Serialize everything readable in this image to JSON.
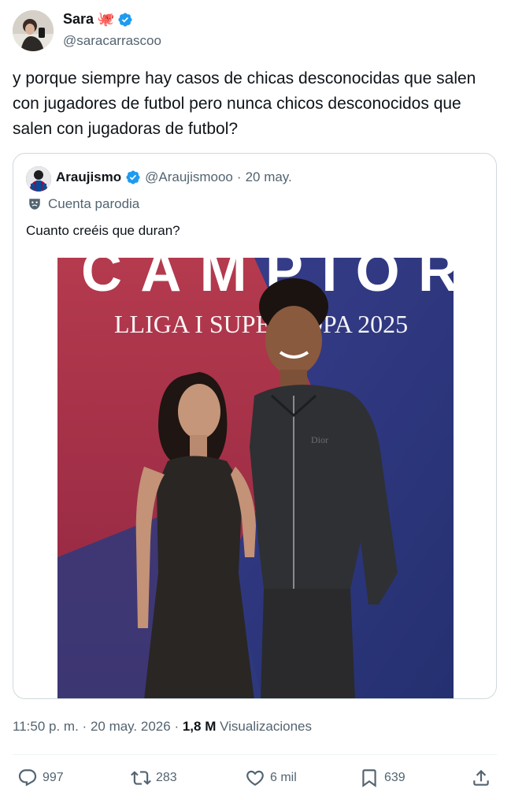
{
  "author": {
    "name": "Sara",
    "emoji": "🐙",
    "handle": "@saracarrascoo"
  },
  "tweet": {
    "text": "y porque siempre hay casos de chicas desconocidas que salen con jugadores de futbol pero nunca chicos desconocidos que salen con jugadoras de futbol?"
  },
  "quote": {
    "name": "Araujismo",
    "handle": "@Araujismooo",
    "separator": "·",
    "date": "20 may.",
    "label": "Cuenta parodia",
    "text": "Cuanto creéis que duran?",
    "image": {
      "banner_top": "CAMPIOR",
      "banner_text": "LLIGA I SUPERCOPA 2025",
      "jacket_brand": "Dior"
    }
  },
  "meta": {
    "time": "11:50 p. m.",
    "sep1": "·",
    "date": "20 may. 2026",
    "sep2": "·",
    "views_count": "1,8 M",
    "views_label": "Visualizaciones"
  },
  "actions": {
    "replies": "997",
    "reposts": "283",
    "likes": "6 mil",
    "bookmarks": "639"
  },
  "colors": {
    "verified": "#1d9bf0",
    "muted": "#536471",
    "border": "#cfd9de"
  }
}
